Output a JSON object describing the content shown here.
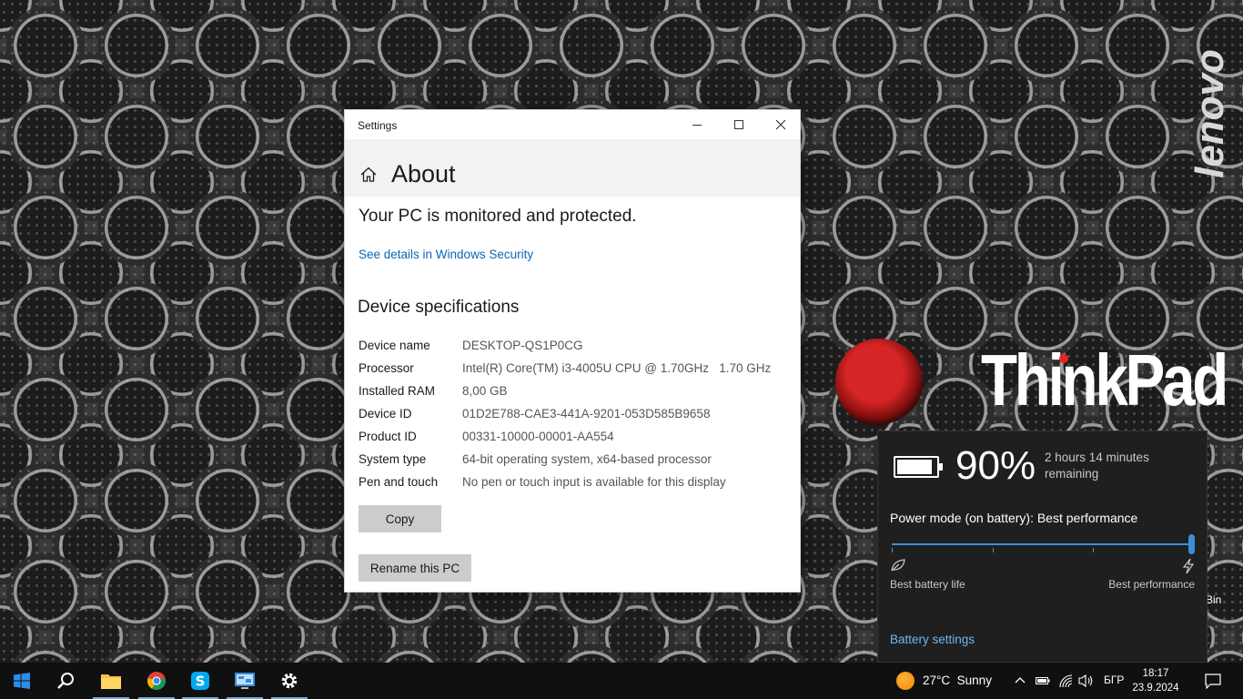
{
  "desktop": {
    "brand_vertical": "lenovo",
    "brand_main": "ThinkPad",
    "recycle_bin_label_partial": "Bin"
  },
  "settings": {
    "window_title": "Settings",
    "page_title": "About",
    "protection_status": "Your PC is monitored and protected.",
    "security_link": "See details in Windows Security",
    "specs_heading": "Device specifications",
    "specs": [
      {
        "label": "Device name",
        "value": "DESKTOP-QS1P0CG"
      },
      {
        "label": "Processor",
        "value": "Intel(R) Core(TM) i3-4005U CPU @ 1.70GHz   1.70 GHz"
      },
      {
        "label": "Installed RAM",
        "value": "8,00 GB"
      },
      {
        "label": "Device ID",
        "value": "01D2E788-CAE3-441A-9201-053D585B9658"
      },
      {
        "label": "Product ID",
        "value": "00331-10000-00001-AA554"
      },
      {
        "label": "System type",
        "value": "64-bit operating system, x64-based processor"
      },
      {
        "label": "Pen and touch",
        "value": "No pen or touch input is available for this display"
      }
    ],
    "copy_button": "Copy",
    "rename_button": "Rename this PC",
    "accent_link_color": "#0a67b6"
  },
  "battery": {
    "percent": "90%",
    "percent_value": 90,
    "remaining": "2 hours 14 minutes remaining",
    "power_mode": "Power mode (on battery): Best performance",
    "slider_level": 1.0,
    "slider_min_label": "Best battery life",
    "slider_max_label": "Best performance",
    "settings_link": "Battery settings",
    "accent_color": "#3b8fd9"
  },
  "taskbar": {
    "apps": [
      {
        "name": "start-icon",
        "active": false
      },
      {
        "name": "search-icon",
        "active": false
      },
      {
        "name": "file-explorer-icon",
        "active": true
      },
      {
        "name": "chrome-icon",
        "active": true
      },
      {
        "name": "skype-icon",
        "active": true
      },
      {
        "name": "control-panel-icon",
        "active": true
      },
      {
        "name": "settings-gear-icon",
        "active": true
      }
    ],
    "weather": "27°C  Sunny",
    "language": "БГР",
    "time": "18:17",
    "date": "23.9.2024 г."
  }
}
